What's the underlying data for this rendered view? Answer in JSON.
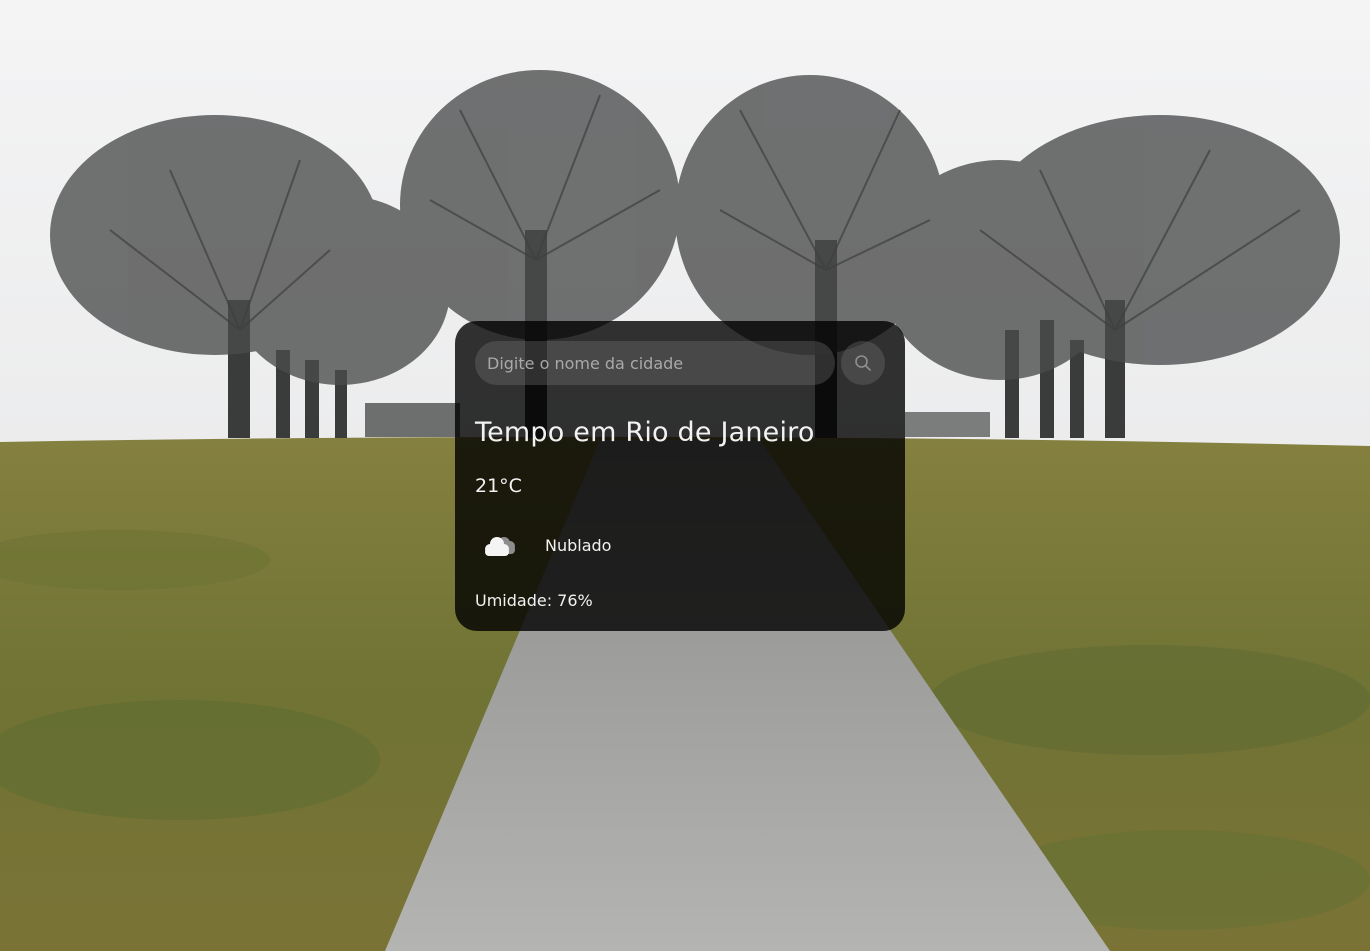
{
  "search": {
    "placeholder": "Digite o nome da cidade",
    "value": "",
    "button_icon": "search-icon"
  },
  "weather": {
    "title": "Tempo em Rio de Janeiro",
    "temperature": "21°C",
    "condition_icon": "cloud-icon",
    "condition": "Nublado",
    "humidity": "Umidade: 76%"
  },
  "colors": {
    "card_background": "#000000",
    "text": "#f2f2f2",
    "input_background": "#7d7d7d",
    "sky": "#eceded",
    "grass": "#7a7a3a",
    "path": "#a8a8a8"
  }
}
